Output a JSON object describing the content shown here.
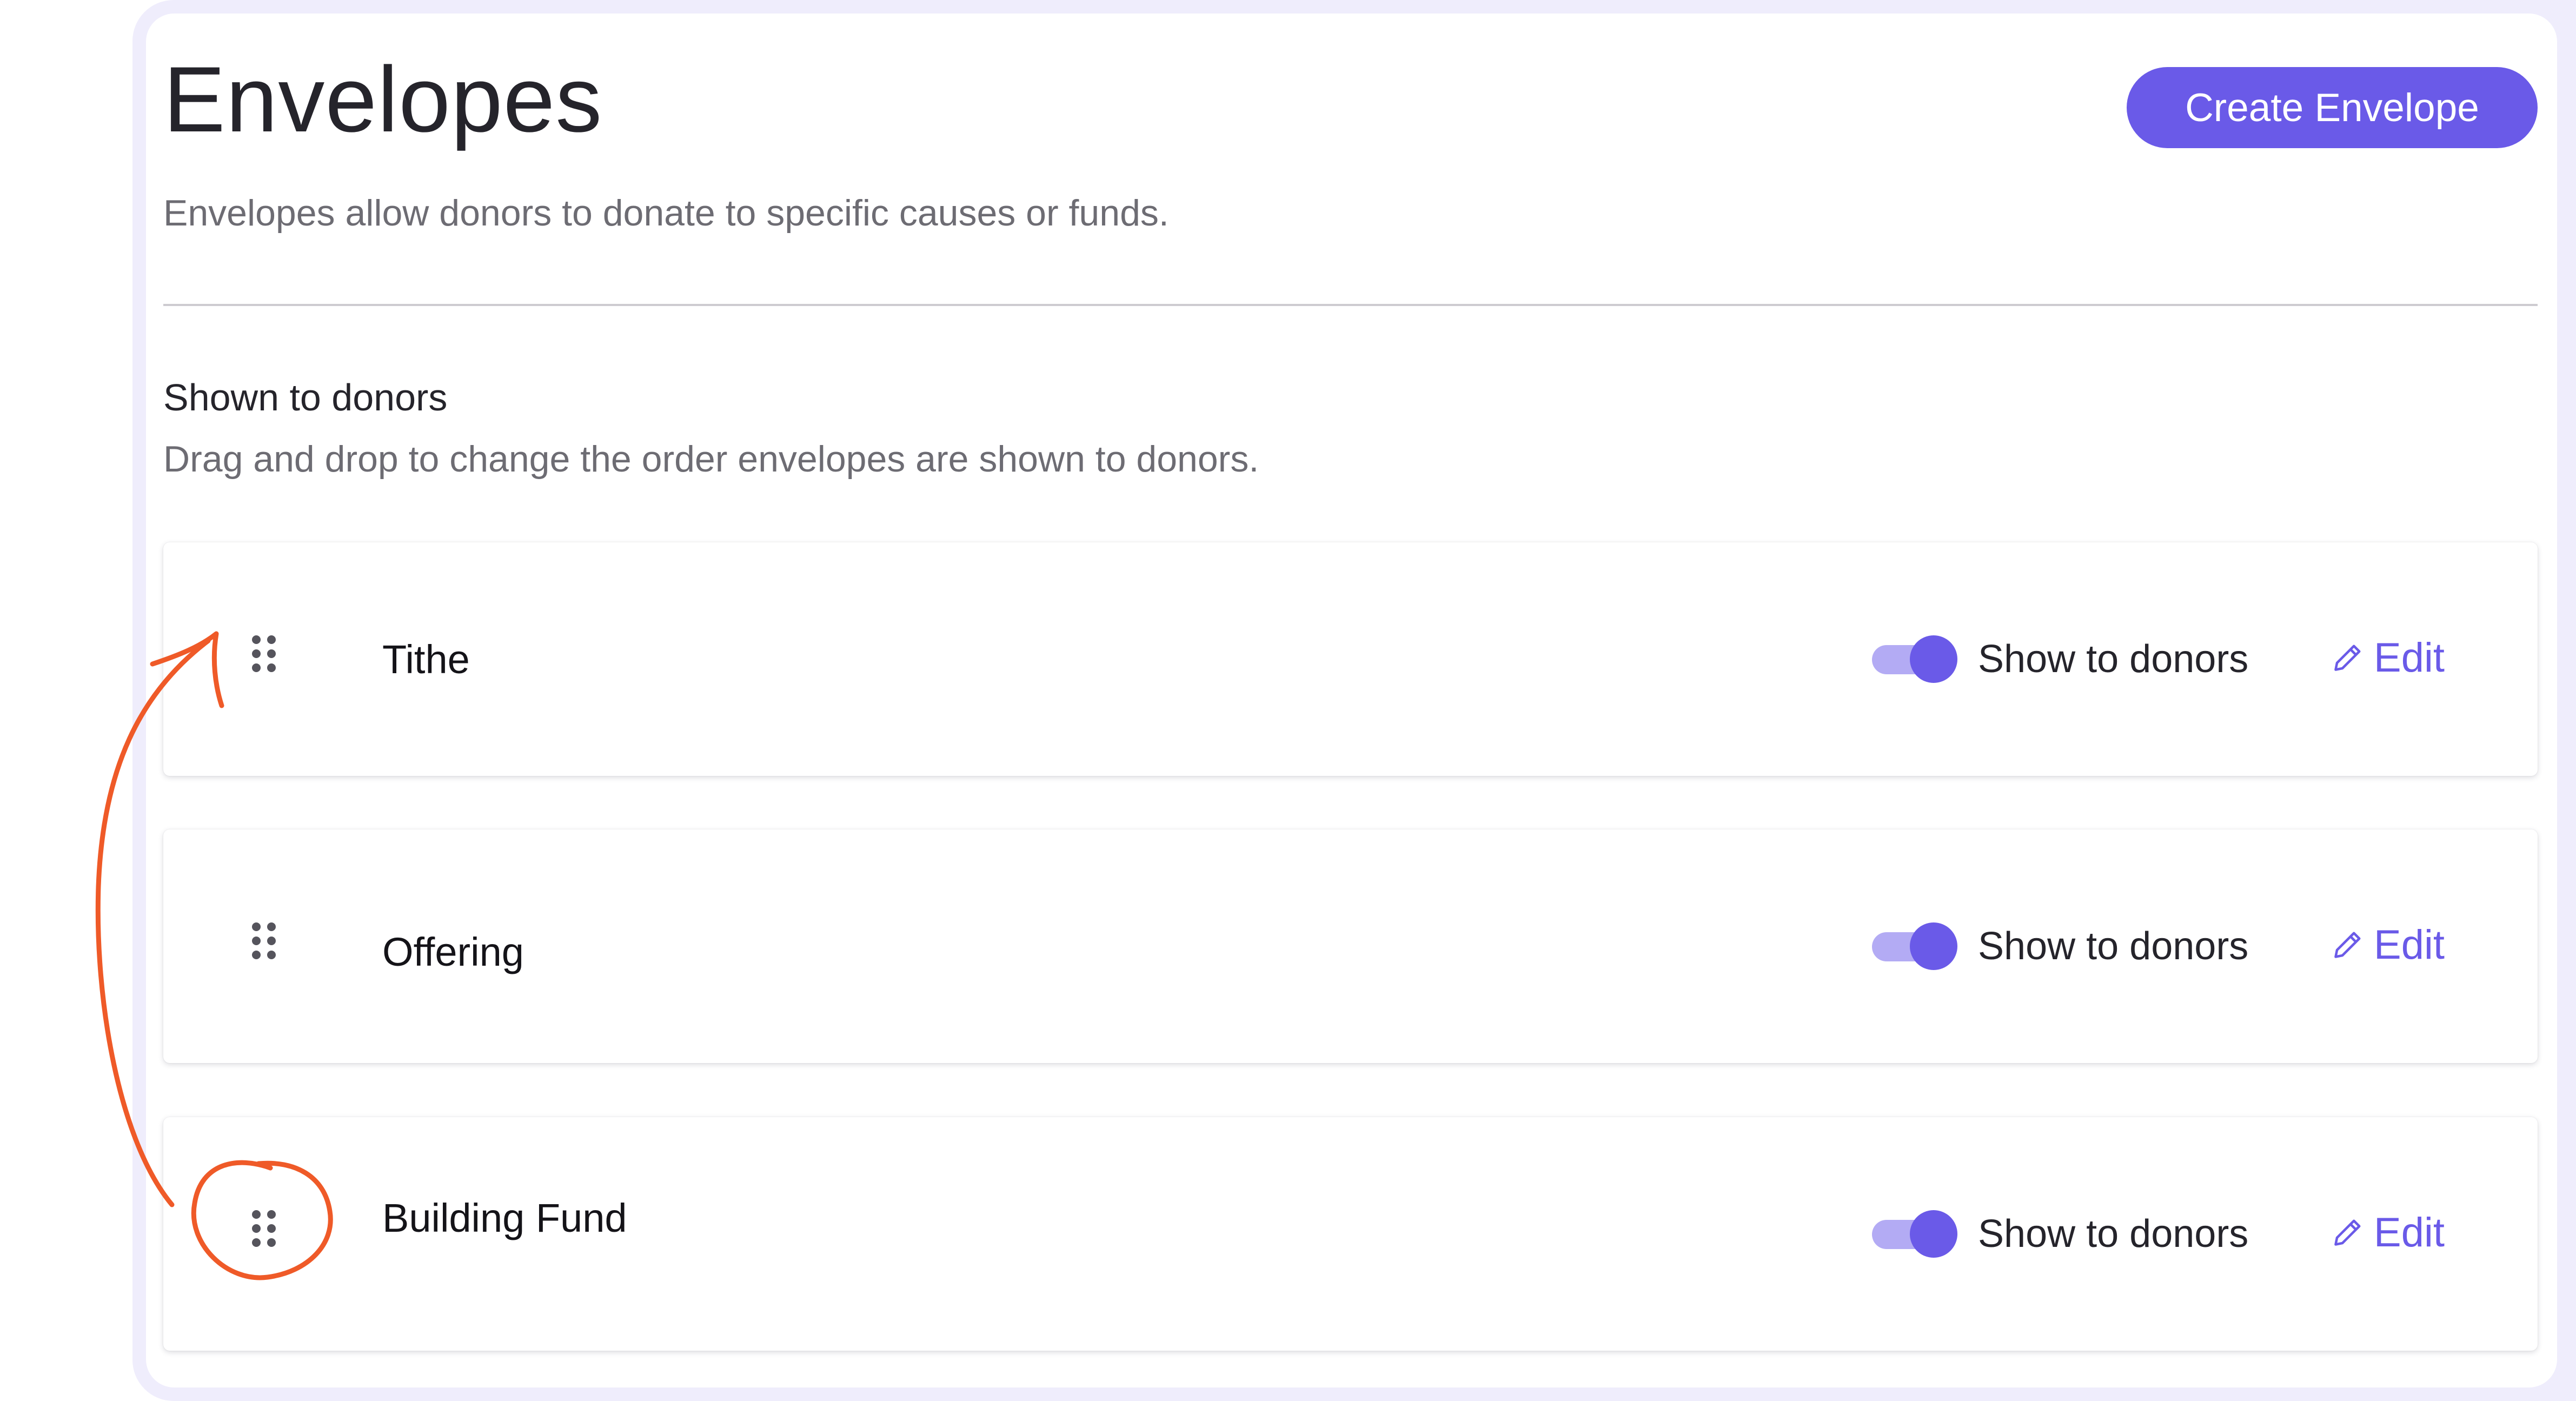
{
  "page": {
    "title": "Envelopes",
    "description": "Envelopes allow donors to donate to specific causes or funds.",
    "create_button_label": "Create Envelope"
  },
  "section": {
    "title": "Shown to donors",
    "description": "Drag and drop to change the order envelopes are shown to donors."
  },
  "envelopes": [
    {
      "name": "Tithe",
      "toggle_label": "Show to donors",
      "toggle_on": true,
      "edit_label": "Edit"
    },
    {
      "name": "Offering",
      "toggle_label": "Show to donors",
      "toggle_on": true,
      "edit_label": "Edit"
    },
    {
      "name": "Building Fund",
      "toggle_label": "Show to donors",
      "toggle_on": true,
      "edit_label": "Edit"
    }
  ],
  "icons": {
    "drag": "drag-handle-icon",
    "edit": "pencil-icon"
  },
  "colors": {
    "accent": "#6a5ae8",
    "toggle_track": "#b3abf4",
    "annotation": "#ef5a28",
    "frame": "#efedfc"
  }
}
